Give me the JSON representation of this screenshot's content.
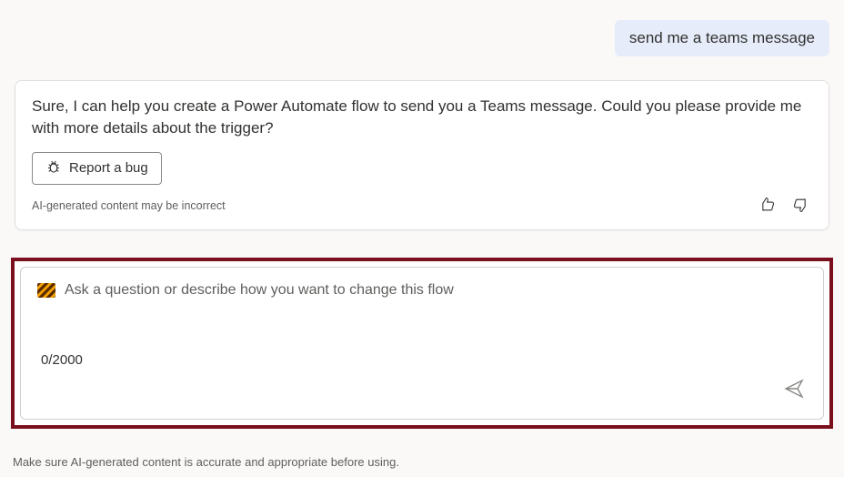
{
  "user_message": "send me a teams message",
  "assistant_message": "Sure, I can help you create a Power Automate flow to send you a Teams message. Could you please provide me with more details about the trigger?",
  "report_button_label": "Report a bug",
  "card_disclaimer": "AI-generated content may be incorrect",
  "input": {
    "placeholder": "Ask a question or describe how you want to change this flow",
    "char_count": "0/2000"
  },
  "page_disclaimer": "Make sure AI-generated content is accurate and appropriate before using."
}
